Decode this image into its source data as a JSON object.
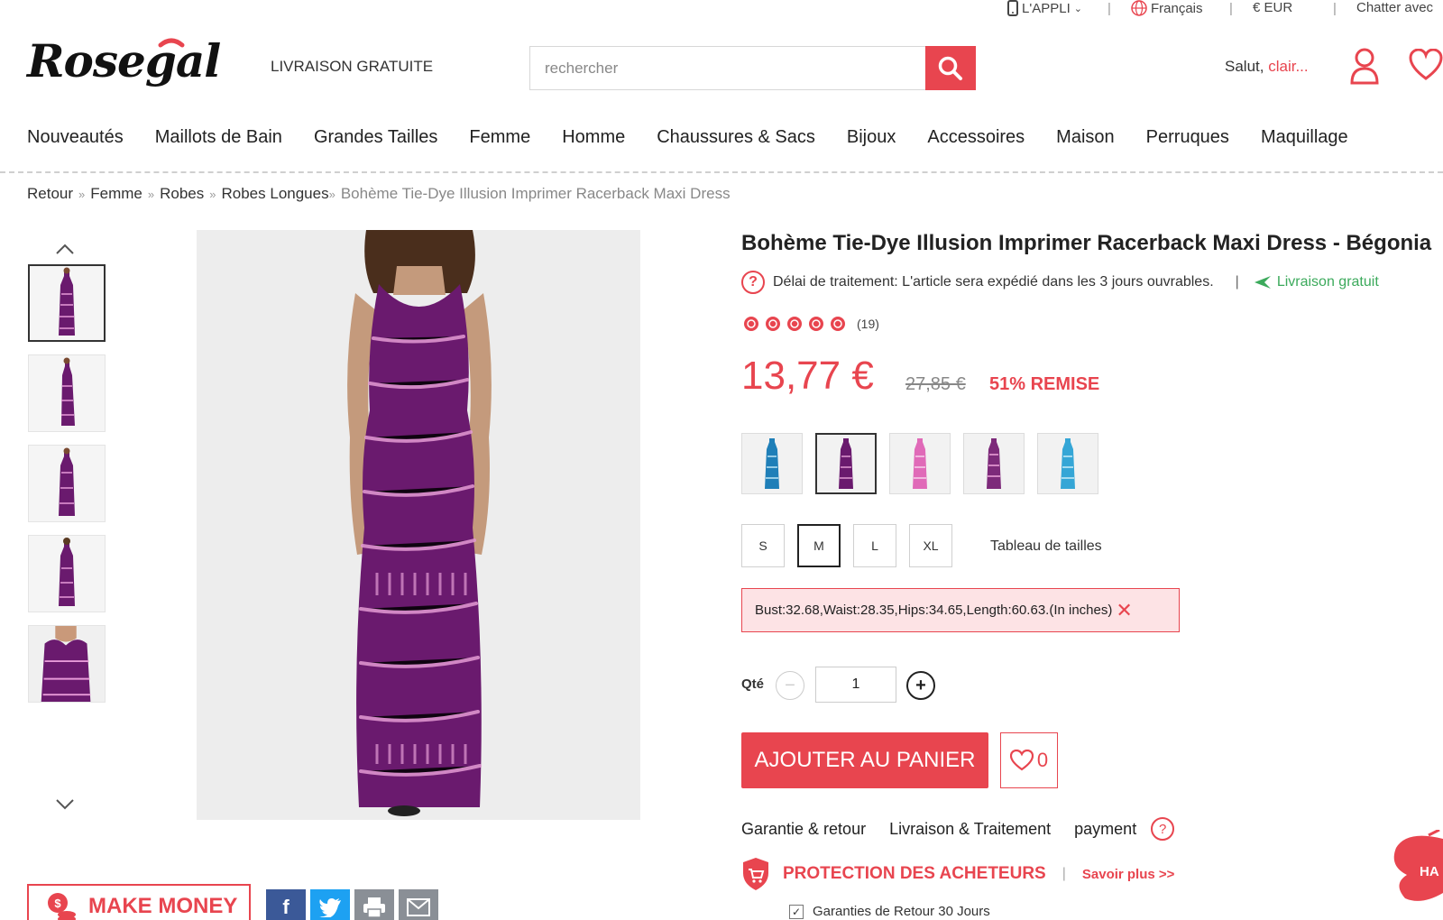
{
  "topbar": {
    "app": "L'APPLI",
    "language": "Français",
    "currency": "€ EUR",
    "chat": "Chatter avec"
  },
  "header": {
    "logo": "Rosegal",
    "free_shipping": "LIVRAISON GRATUITE",
    "search_placeholder": "rechercher",
    "greeting": "Salut,",
    "username": "clair..."
  },
  "nav": {
    "items": [
      "Nouveautés",
      "Maillots de Bain",
      "Grandes Tailles",
      "Femme",
      "Homme",
      "Chaussures & Sacs",
      "Bijoux",
      "Accessoires",
      "Maison",
      "Perruques",
      "Maquillage"
    ]
  },
  "breadcrumb": {
    "items": [
      "Retour",
      "Femme",
      "Robes",
      "Robes Longues"
    ],
    "current": "Bohème Tie-Dye Illusion Imprimer Racerback Maxi Dress"
  },
  "product": {
    "title": "Bohème Tie-Dye Illusion Imprimer Racerback Maxi Dress - Bégonia",
    "processing": "Délai de traitement: L'article sera expédié dans les 3 jours ouvrables.",
    "processing_sep": "|",
    "free_delivery": "Livraison gratuit",
    "rating_stars": 5,
    "review_count": "(19)",
    "price": "13,77 €",
    "old_price": "27,85 €",
    "discount": "51% REMISE",
    "colors": [
      "blue",
      "purple",
      "pink",
      "purple-alt",
      "sky-blue"
    ],
    "sizes": [
      "S",
      "M",
      "L",
      "XL"
    ],
    "selected_size": "M",
    "size_chart": "Tableau de tailles",
    "measurements": "Bust:32.68,Waist:28.35,Hips:34.65,Length:60.63.(In inches)",
    "qty_label": "Qté",
    "qty_value": "1",
    "add_to_cart": "AJOUTER AU PANIER",
    "wishlist_count": "0"
  },
  "info_tabs": [
    "Garantie & retour",
    "Livraison & Traitement",
    "payment"
  ],
  "protection": {
    "title": "PROTECTION DES ACHETEURS",
    "sep": "|",
    "more": "Savoir plus >>",
    "guarantee": "Garanties de Retour 30 Jours"
  },
  "promo": {
    "make_money": "MAKE MONEY",
    "side_badge": "HA"
  },
  "colors": {
    "accent": "#e8454f",
    "dress": "#6a1a6e",
    "green": "#3caa5c"
  }
}
